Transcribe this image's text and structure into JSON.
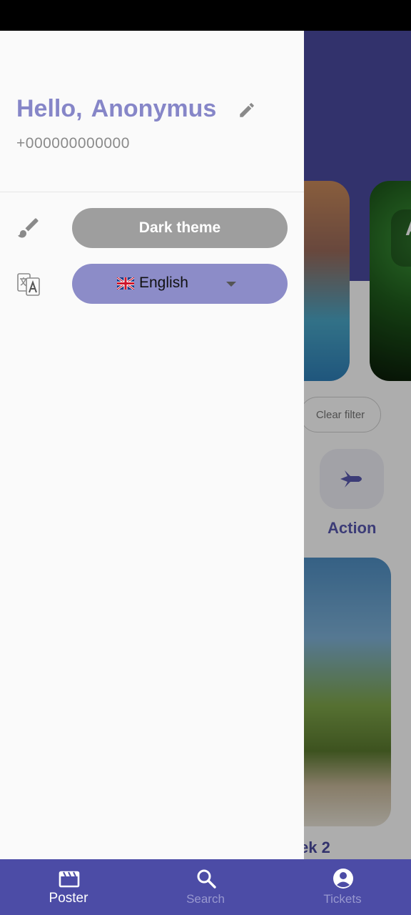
{
  "drawer": {
    "greeting_prefix": "Hello,",
    "user_name": "Anonymus",
    "phone": "+000000000000",
    "theme_button_label": "Dark theme",
    "language": {
      "flag": "🇬🇧",
      "label": "English"
    }
  },
  "background": {
    "clear_filter_label": "Clear filter",
    "genre_label": "Action",
    "card_letter": "A",
    "poster_title_fragment": "ek 2"
  },
  "bottom_nav": {
    "items": [
      {
        "label": "Poster",
        "icon": "clapperboard-icon",
        "active": true
      },
      {
        "label": "Search",
        "icon": "search-icon",
        "active": false
      },
      {
        "label": "Tickets",
        "icon": "account-circle-icon",
        "active": false
      }
    ]
  },
  "colors": {
    "accent": "#8686c8",
    "nav_background": "#4c4ca6",
    "theme_button": "#9e9e9e",
    "language_button": "#8c8cc8"
  }
}
